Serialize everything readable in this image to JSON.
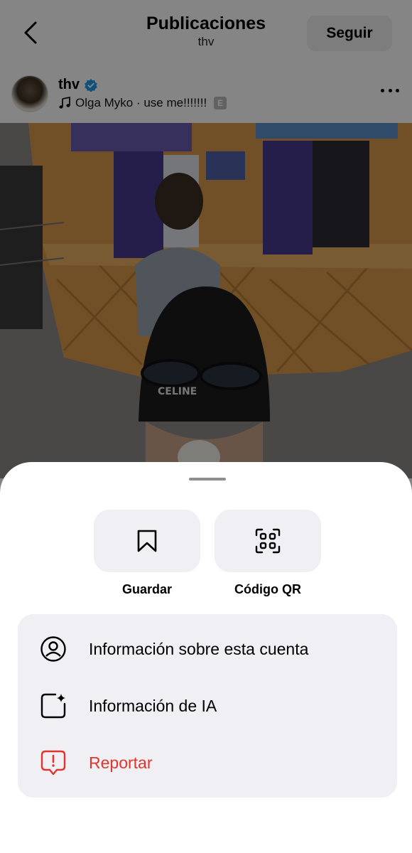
{
  "header": {
    "title": "Publicaciones",
    "subtitle": "thv",
    "follow_label": "Seguir",
    "back_icon": "chevron-left-icon"
  },
  "post": {
    "username": "thv",
    "verified": true,
    "music": "Olga Myko · use me!!!!!!!",
    "explicit_badge": "E",
    "more_icon": "more-horizontal-icon"
  },
  "sheet": {
    "actions": [
      {
        "label": "Guardar",
        "icon": "bookmark-icon"
      },
      {
        "label": "Código QR",
        "icon": "qr-code-icon"
      }
    ],
    "menu": [
      {
        "label": "Información sobre esta cuenta",
        "icon": "account-info-icon"
      },
      {
        "label": "Información de IA",
        "icon": "ai-sparkle-icon"
      },
      {
        "label": "Reportar",
        "icon": "report-icon"
      }
    ]
  },
  "colors": {
    "accent_blue": "#1d9bf0",
    "report_red": "#e0352c",
    "tile_bg": "#efeff4"
  }
}
